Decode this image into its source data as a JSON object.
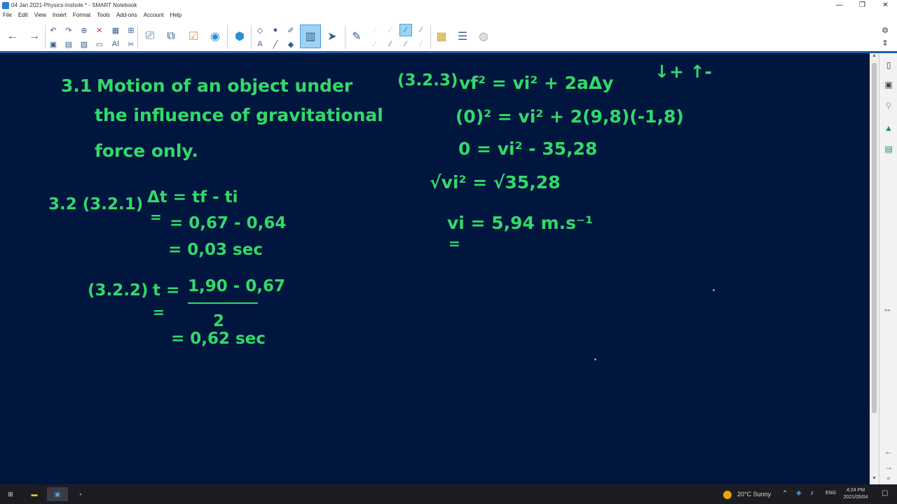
{
  "window": {
    "title": "04 Jan 2021-Physics-Inshole * - SMART Notebook",
    "minimize": "—",
    "restore": "❐",
    "close": "✕"
  },
  "menu": [
    "File",
    "Edit",
    "View",
    "Insert",
    "Format",
    "Tools",
    "Add-ons",
    "Account",
    "Help"
  ],
  "toolbar": {
    "back": "←",
    "forward": "→",
    "undo": "↶",
    "redo": "↷",
    "add_page": "⊕",
    "delete": "✕",
    "table": "▦",
    "pen": "✎",
    "select": "➤",
    "eraser": "◆",
    "text": "A",
    "line": "╱",
    "settings": "⚙",
    "updown": "⇕"
  },
  "canvas": {
    "left": {
      "heading_num": "3.1",
      "heading_l1": "Motion of an object under",
      "heading_l2": "the influence of gravitational",
      "heading_l3": "force only.",
      "q32_label": "3.2 (3.2.1)",
      "q321_l1": "Δt = tf - ti",
      "q321_l2": "= 0,67 - 0,64",
      "q321_l3": "= 0,03 sec",
      "q322_label": "(3.2.2)",
      "q322_t": "t =",
      "q322_num": "1,90 - 0,67",
      "q322_den": "2",
      "q322_res": "= 0,62 sec"
    },
    "right": {
      "label": "(3.2.3)",
      "eq1": "vf² = vi² + 2aΔy",
      "eq2": "(0)² = vi² + 2(9,8)(-1,8)",
      "eq3": "0  = vi² - 35,28",
      "eq4": "√vi² = √35,28",
      "eq5": "vi = 5,94 m.s⁻¹",
      "underline": "=",
      "direction": "↓+ ↑-"
    }
  },
  "taskbar": {
    "weather": "20°C  Sunny",
    "lang": "ENG",
    "time": "4:24 PM",
    "date": "2021/05/04"
  }
}
